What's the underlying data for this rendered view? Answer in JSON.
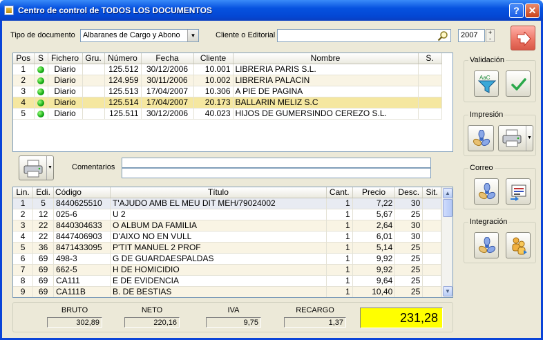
{
  "window": {
    "title": "Centro de control de TODOS LOS DOCUMENTOS",
    "help_label": "?",
    "close_label": "✕"
  },
  "filters": {
    "tipo_label": "Tipo de documento",
    "tipo_value": "Albaranes de Cargo y Abono",
    "cliente_label": "Cliente o Editorial",
    "cliente_value": "",
    "year": "2007"
  },
  "documents": {
    "columns": [
      "Pos",
      "S",
      "Fichero",
      "Gru.",
      "Número",
      "Fecha",
      "Cliente",
      "Nombre",
      "S."
    ],
    "rows": [
      {
        "pos": "1",
        "fichero": "Diario",
        "gru": "",
        "numero": "125.512",
        "fecha": "30/12/2006",
        "cliente": "10.001",
        "nombre": "LIBRERIA PARIS S.L.",
        "s2": ""
      },
      {
        "pos": "2",
        "fichero": "Diario",
        "gru": "",
        "numero": "124.959",
        "fecha": "30/11/2006",
        "cliente": "10.002",
        "nombre": "LIBRERIA PALACIN",
        "s2": ""
      },
      {
        "pos": "3",
        "fichero": "Diario",
        "gru": "",
        "numero": "125.513",
        "fecha": "17/04/2007",
        "cliente": "10.306",
        "nombre": "A PIE DE PAGINA",
        "s2": ""
      },
      {
        "pos": "4",
        "fichero": "Diario",
        "gru": "",
        "numero": "125.514",
        "fecha": "17/04/2007",
        "cliente": "20.173",
        "nombre": "BALLARIN MELIZ S.C",
        "s2": ""
      },
      {
        "pos": "5",
        "fichero": "Diario",
        "gru": "",
        "numero": "125.511",
        "fecha": "30/12/2006",
        "cliente": "40.023",
        "nombre": "HIJOS DE GUMERSINDO CEREZO S.L.",
        "s2": ""
      }
    ],
    "selected_index": 3
  },
  "comments": {
    "label": "Comentarios",
    "line1": "",
    "line2": ""
  },
  "lines": {
    "columns": [
      "Lin.",
      "Edi.",
      "Código",
      "Título",
      "Cant.",
      "Precio",
      "Desc.",
      "Sit."
    ],
    "rows": [
      {
        "lin": "1",
        "edi": "5",
        "codigo": "8440625510",
        "titulo": "T'AJUDO AMB EL MEU DIT MEH/79024002",
        "cant": "1",
        "precio": "7,22",
        "desc": "30",
        "sit": ""
      },
      {
        "lin": "2",
        "edi": "12",
        "codigo": "025-6",
        "titulo": "U 2",
        "cant": "1",
        "precio": "5,67",
        "desc": "25",
        "sit": ""
      },
      {
        "lin": "3",
        "edi": "22",
        "codigo": "8440304633",
        "titulo": "O ALBUM DA FAMILIA",
        "cant": "1",
        "precio": "2,64",
        "desc": "30",
        "sit": ""
      },
      {
        "lin": "4",
        "edi": "22",
        "codigo": "8447406903",
        "titulo": "D'AIXO NO EN VULL",
        "cant": "1",
        "precio": "6,01",
        "desc": "30",
        "sit": ""
      },
      {
        "lin": "5",
        "edi": "36",
        "codigo": "8471433095",
        "titulo": "P'TIT MANUEL 2 PROF",
        "cant": "1",
        "precio": "5,14",
        "desc": "25",
        "sit": ""
      },
      {
        "lin": "6",
        "edi": "69",
        "codigo": "498-3",
        "titulo": "G DE GUARDAESPALDAS",
        "cant": "1",
        "precio": "9,92",
        "desc": "25",
        "sit": ""
      },
      {
        "lin": "7",
        "edi": "69",
        "codigo": "662-5",
        "titulo": "H DE HOMICIDIO",
        "cant": "1",
        "precio": "9,92",
        "desc": "25",
        "sit": ""
      },
      {
        "lin": "8",
        "edi": "69",
        "codigo": "CA111",
        "titulo": "E DE EVIDENCIA",
        "cant": "1",
        "precio": "9,64",
        "desc": "25",
        "sit": ""
      },
      {
        "lin": "9",
        "edi": "69",
        "codigo": "CA111B",
        "titulo": "B. DE BESTIAS",
        "cant": "1",
        "precio": "10,40",
        "desc": "25",
        "sit": ""
      }
    ],
    "selected_index": 0
  },
  "groups": {
    "validacion": "Validación",
    "impresion": "Impresión",
    "correo": "Correo",
    "integracion": "Integración"
  },
  "totals": {
    "bruto_label": "BRUTO",
    "bruto": "302,89",
    "neto_label": "NETO",
    "neto": "220,16",
    "iva_label": "IVA",
    "iva": "9,75",
    "recargo_label": "RECARGO",
    "recargo": "1,37",
    "total": "231,28"
  },
  "icons": {
    "exit": "exit-arrow-icon",
    "search": "magnifier-icon",
    "filter": "funnel-abc-icon",
    "check": "checkmark-icon",
    "fan": "pinwheel-icon",
    "printer": "printer-icon",
    "mail": "mail-icon",
    "people": "people-icon"
  },
  "colors": {
    "total_bg": "#ffff00",
    "selected_row": "#f5e7a0",
    "status_ok": "#12a812"
  }
}
